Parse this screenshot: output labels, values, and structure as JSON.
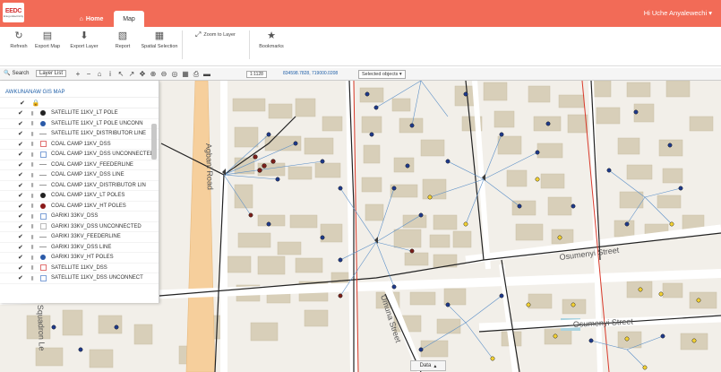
{
  "app": {
    "logo_main": "EEDC",
    "logo_sub": "Enugu Electricity"
  },
  "tabs": {
    "home": "Home",
    "map": "Map"
  },
  "user": {
    "greeting": "Hi Uche Anyalewechi"
  },
  "ribbon": {
    "refresh": "Refresh",
    "export_map": "Export Map",
    "export_layer": "Export Layer",
    "report": "Report",
    "spatial_selection": "Spatial Selection",
    "zoom_to_layer": "Zoom to Layer",
    "bookmarks": "Bookmarks"
  },
  "toolbar": {
    "search": "Search",
    "layer_list": "Layer List",
    "scale": "1:1128",
    "coords": "834598.7828, 719000.0208",
    "selected_objects": "Selected objects"
  },
  "panel": {
    "title": "AWKUNANAW GIS MAP",
    "layers": [
      {
        "name": "SATELLITE 11KV_LT POLE",
        "symbol": "dot-black"
      },
      {
        "name": "SATELLITE 11KV_LT POLE UNCONN",
        "symbol": "dot-blue"
      },
      {
        "name": "SATELLITE 11KV_DISTRIBUTOR LINE",
        "symbol": "line-gray"
      },
      {
        "name": "COAL CAMP 11KV_DSS",
        "symbol": "box-red"
      },
      {
        "name": "COAL CAMP 11KV_DSS UNCONNECTED",
        "symbol": "box-blue"
      },
      {
        "name": "COAL CAMP 11KV_FEEDERLINE",
        "symbol": "line-gray"
      },
      {
        "name": "COAL CAMP 11KV_DSS LINE",
        "symbol": "line-gray"
      },
      {
        "name": "COAL CAMP 11KV_DISTRIBUTOR LIN",
        "symbol": "line-gray"
      },
      {
        "name": "COAL CAMP 11KV_LT POLES",
        "symbol": "dot-black"
      },
      {
        "name": "COAL CAMP 11KV_HT POLES",
        "symbol": "dot-red"
      },
      {
        "name": "GARIKI 33KV_DSS",
        "symbol": "box-blue"
      },
      {
        "name": "GARIKI 33KV_DSS UNCONNECTED",
        "symbol": "box-gray"
      },
      {
        "name": "GARIKI 33KV_FEEDERLINE",
        "symbol": "line-gray"
      },
      {
        "name": "GARIKI 33KV_DSS LINE",
        "symbol": "line-gray"
      },
      {
        "name": "GARIKI 33KV_HT POLES",
        "symbol": "dot-blue"
      },
      {
        "name": "SATELLITE 11KV_DSS",
        "symbol": "box-red"
      },
      {
        "name": "SATELLITE 11KV_DSS UNCONNECT",
        "symbol": "box-blue"
      }
    ]
  },
  "map": {
    "streets": [
      "Agbani Road",
      "Osumenyi Street",
      "Osumenyi Street",
      "Umuna Street",
      "Squadron Le"
    ],
    "data_button": "Data"
  },
  "colors": {
    "accent": "#f26b57",
    "road": "#f6cf9c",
    "building": "#d8cfb9",
    "line": "#5b8fc7"
  }
}
